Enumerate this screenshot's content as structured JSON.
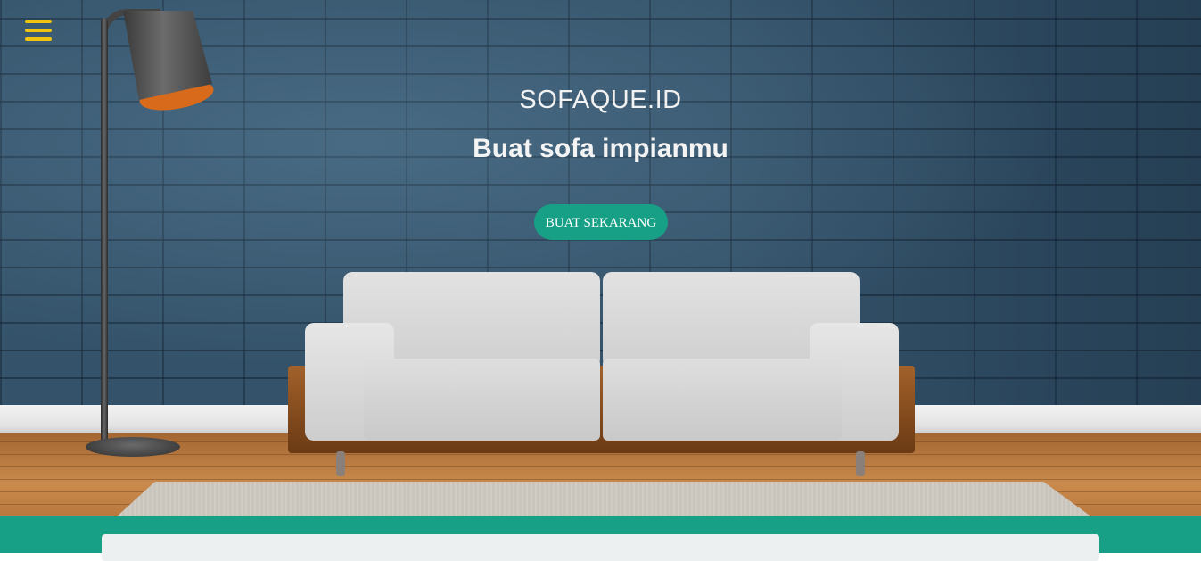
{
  "brand": "SOFAQUE.ID",
  "hero": {
    "tagline": "Buat sofa impianmu",
    "cta_label": "BUAT SEKARANG"
  },
  "icons": {
    "menu": "hamburger-menu-icon"
  },
  "colors": {
    "accent": "#17a085",
    "menu_icon": "#f1c40f",
    "card_bg": "#ecf0f1"
  }
}
